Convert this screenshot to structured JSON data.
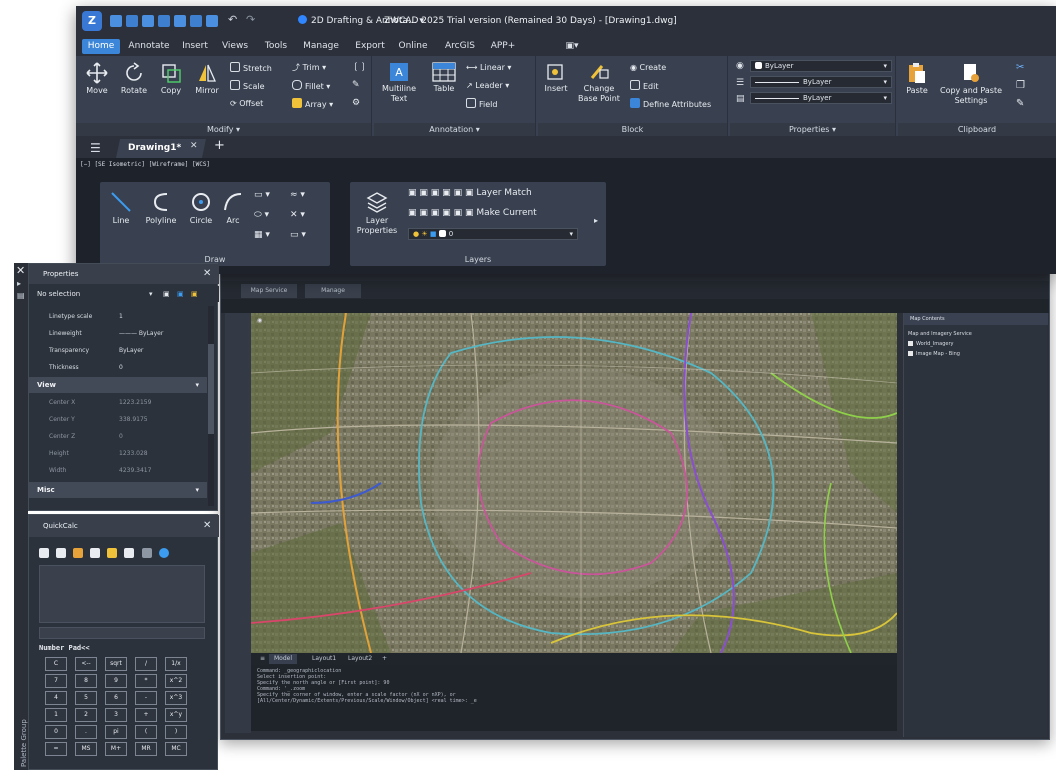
{
  "window": {
    "title": "ZWCAD 2025 Trial version (Remained 30 Days) - [Drawing1.dwg]",
    "workspace": "2D Drafting & Annota...",
    "menus": [
      "Home",
      "Annotate",
      "Insert",
      "Views",
      "Tools",
      "Manage",
      "Export",
      "Online",
      "ArcGIS",
      "APP+"
    ]
  },
  "ribbon": {
    "modify": {
      "title": "Modify",
      "big": [
        "Move",
        "Rotate",
        "Copy",
        "Mirror"
      ],
      "small": [
        "Stretch",
        "Trim",
        "Scale",
        "Fillet",
        "Offset",
        "Array"
      ]
    },
    "annotation": {
      "title": "Annotation",
      "big": [
        "Multiline Text",
        "Table"
      ],
      "small": [
        "Linear",
        "Leader",
        "Field"
      ]
    },
    "block": {
      "title": "Block",
      "big": [
        "Insert",
        "Change Base Point"
      ],
      "small": [
        "Create",
        "Edit",
        "Define Attributes"
      ]
    },
    "properties": {
      "title": "Properties",
      "color": "ByLayer",
      "linetype": "ByLayer",
      "lineweight": "ByLayer"
    },
    "clipboard": {
      "title": "Clipboard",
      "big": [
        "Paste",
        "Copy and Paste Settings"
      ]
    }
  },
  "file_tabs": {
    "active": "Drawing1*"
  },
  "viewport_label": "[−] [SE Isometric] [Wireframe] [WCS]",
  "draw_toolbar": {
    "title": "Draw",
    "tools": [
      "Line",
      "Polyline",
      "Circle",
      "Arc"
    ]
  },
  "layers_toolbar": {
    "title": "Layers",
    "big": "Layer Properties",
    "actions": [
      "Layer Match",
      "Make Current"
    ],
    "current_layer": "0"
  },
  "back_window": {
    "tabs": [
      "Map Service",
      "Manage"
    ],
    "layout_tabs": [
      "Model",
      "Layout1",
      "Layout2"
    ],
    "command_lines": [
      "Command: _geographiclocation",
      "Select insertion point:",
      "Specify the north angle or [First point]: 90",
      "Command: '_.zoom",
      "Specify the corner of window, enter a scale factor (nX or nXP), or",
      "[All/Center/Dynamic/Extents/Previous/Scale/Window/Object] <real time>: _e"
    ],
    "map_contents": {
      "title": "Map Contents",
      "items": [
        "Map and Imagery Service",
        "World_Imagery",
        "Image Map - Bing"
      ]
    }
  },
  "properties_palette": {
    "title": "Properties",
    "selection": "No selection",
    "general_rows": [
      {
        "key": "Linetype scale",
        "value": "1"
      },
      {
        "key": "Lineweight",
        "value": "——— ByLayer"
      },
      {
        "key": "Transparency",
        "value": "ByLayer"
      },
      {
        "key": "Thickness",
        "value": "0"
      }
    ],
    "view_section": "View",
    "view_rows": [
      {
        "key": "Center X",
        "value": "1223.2159"
      },
      {
        "key": "Center Y",
        "value": "338.9175"
      },
      {
        "key": "Center Z",
        "value": "0"
      },
      {
        "key": "Height",
        "value": "1233.028"
      },
      {
        "key": "Width",
        "value": "4239.3417"
      }
    ],
    "misc_section": "Misc"
  },
  "quickcalc": {
    "title": "QuickCalc",
    "numpad_label": "Number Pad<<",
    "keys": [
      [
        "C",
        "<--",
        "sqrt",
        "/",
        "1/x"
      ],
      [
        "7",
        "8",
        "9",
        "*",
        "x^2"
      ],
      [
        "4",
        "5",
        "6",
        "-",
        "x^3"
      ],
      [
        "1",
        "2",
        "3",
        "+",
        "x^y"
      ],
      [
        "0",
        ".",
        "pi",
        "(",
        ")"
      ],
      [
        "=",
        "MS",
        "M+",
        "MR",
        "MC"
      ]
    ]
  },
  "side_strip": {
    "title": "Palette Group"
  },
  "colors": {
    "accent": "#3b86d8",
    "panel": "#394150",
    "dark": "#1e232b"
  }
}
